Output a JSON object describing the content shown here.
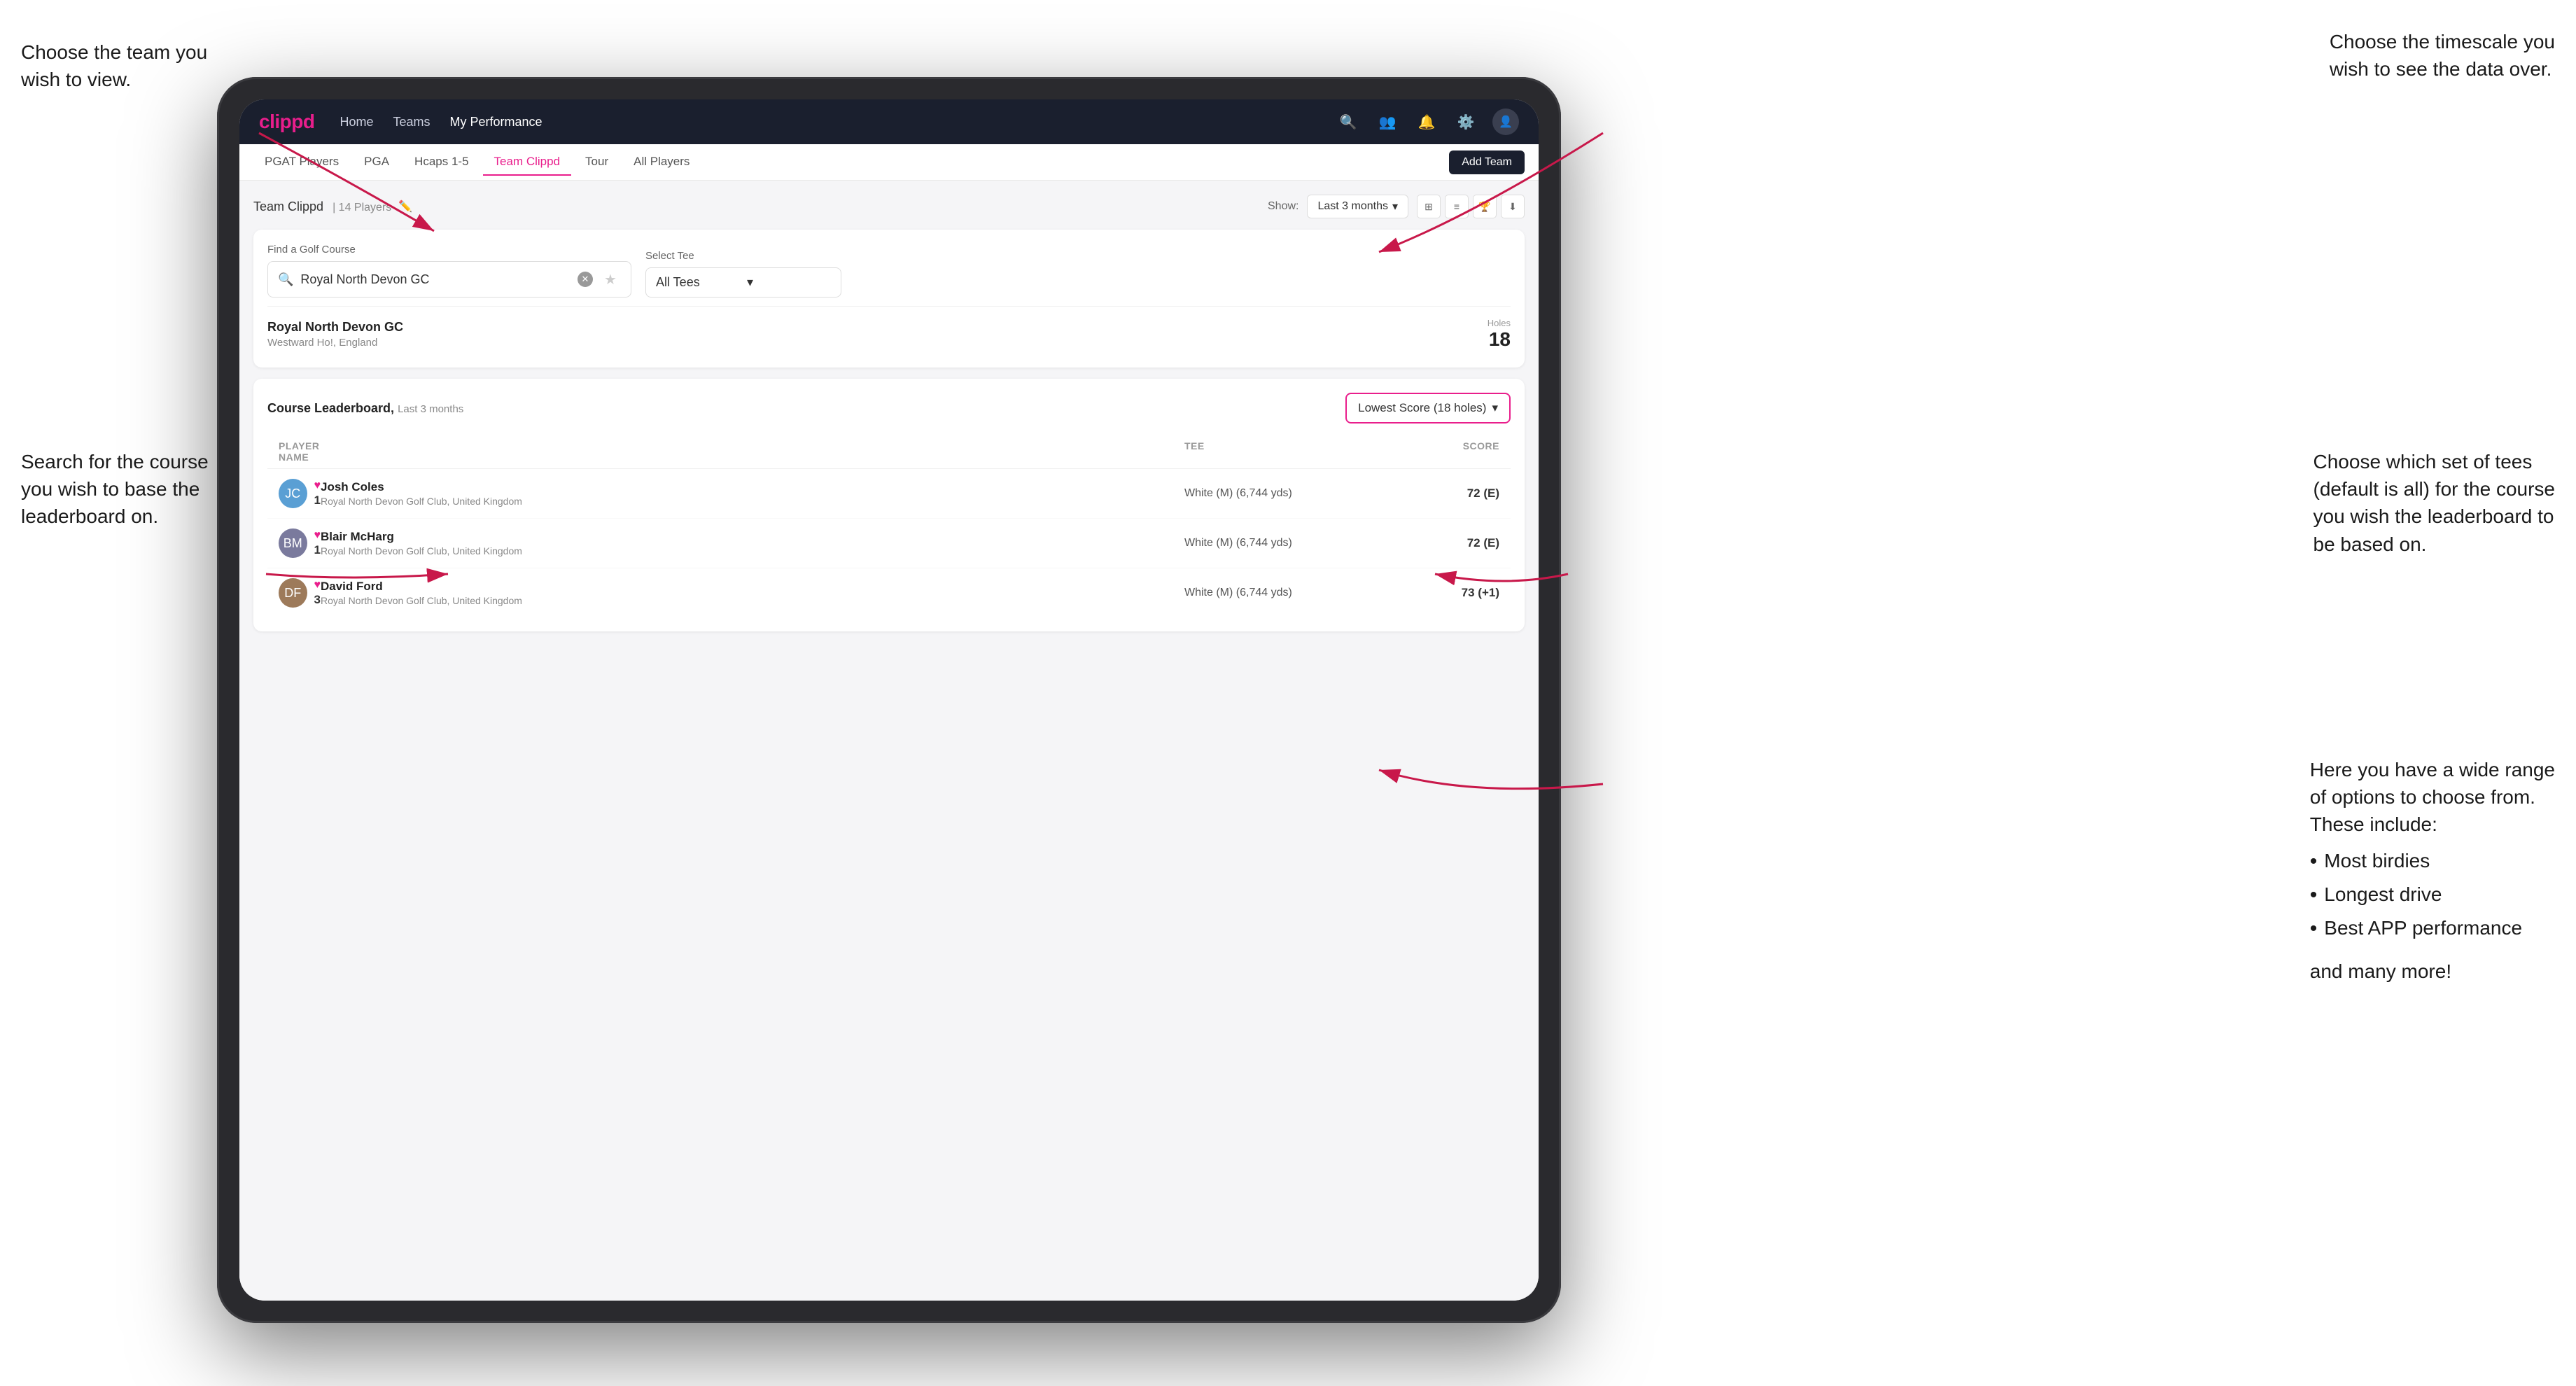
{
  "app": {
    "logo": "clippd",
    "nav": {
      "links": [
        "Home",
        "Teams",
        "My Performance"
      ],
      "active_link": "My Performance"
    },
    "sub_tabs": [
      "PGAT Players",
      "PGA",
      "Hcaps 1-5",
      "Team Clippd",
      "Tour",
      "All Players"
    ],
    "active_sub_tab": "Team Clippd",
    "add_team_button": "Add Team"
  },
  "team_header": {
    "title": "Team Clippd",
    "player_count": "14 Players",
    "show_label": "Show:",
    "show_value": "Last 3 months"
  },
  "course_search": {
    "find_label": "Find a Golf Course",
    "search_placeholder": "Royal North Devon GC",
    "select_tee_label": "Select Tee",
    "tee_value": "All Tees"
  },
  "course_result": {
    "name": "Royal North Devon GC",
    "location": "Westward Ho!, England",
    "holes_label": "Holes",
    "holes_value": "18"
  },
  "leaderboard": {
    "title": "Course Leaderboard,",
    "subtitle": "Last 3 months",
    "score_type": "Lowest Score (18 holes)",
    "columns": {
      "player_name": "PLAYER NAME",
      "tee": "TEE",
      "score": "SCORE"
    },
    "rows": [
      {
        "rank": "1",
        "name": "Josh Coles",
        "club": "Royal North Devon Golf Club, United Kingdom",
        "tee": "White (M) (6,744 yds)",
        "score": "72 (E)",
        "avatar_initials": "JC",
        "avatar_class": "jc"
      },
      {
        "rank": "1",
        "name": "Blair McHarg",
        "club": "Royal North Devon Golf Club, United Kingdom",
        "tee": "White (M) (6,744 yds)",
        "score": "72 (E)",
        "avatar_initials": "BM",
        "avatar_class": "bm"
      },
      {
        "rank": "3",
        "name": "David Ford",
        "club": "Royal North Devon Golf Club, United Kingdom",
        "tee": "White (M) (6,744 yds)",
        "score": "73 (+1)",
        "avatar_initials": "DF",
        "avatar_class": "df"
      }
    ]
  },
  "annotations": {
    "top_left_title": "Choose the team you\nwish to view.",
    "top_right_title": "Choose the timescale you\nwish to see the data over.",
    "mid_left_title": "Search for the course\nyou wish to base the\nleaderboard on.",
    "mid_right_title": "Choose which set of tees\n(default is all) for the course\nyou wish the leaderboard to\nbe based on.",
    "bottom_right_title": "Here you have a wide range\nof options to choose from.\nThese include:",
    "bullet_items": [
      "Most birdies",
      "Longest drive",
      "Best APP performance"
    ],
    "and_more": "and many more!"
  }
}
